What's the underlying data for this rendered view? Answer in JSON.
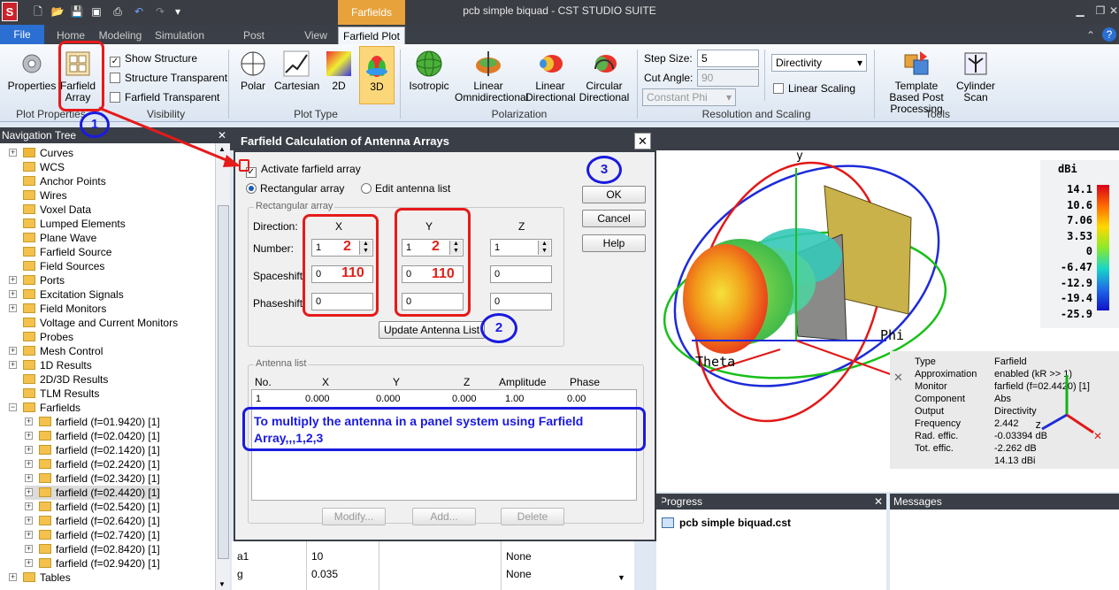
{
  "window": {
    "title": "pcb simple biquad - CST STUDIO SUITE",
    "context_tab_group": "Farfields"
  },
  "tabs": [
    "File",
    "Home",
    "Modeling",
    "Simulation",
    "Post Processing",
    "View",
    "Farfield Plot"
  ],
  "ribbon": {
    "properties": "Properties",
    "farfield_array": "Farfield Array",
    "plot_properties_label": "Plot Properties",
    "show_structure": "Show Structure",
    "structure_transparent": "Structure Transparent",
    "farfield_transparent": "Farfield Transparent",
    "visibility_label": "Visibility",
    "polar": "Polar",
    "cartesian": "Cartesian",
    "2d": "2D",
    "3d": "3D",
    "plot_type_label": "Plot Type",
    "isotropic": "Isotropic",
    "linear_omni": "Linear Omnidirectional",
    "linear_dir": "Linear Directional",
    "circular_dir": "Circular Directional",
    "polarization_label": "Polarization",
    "step_size_label": "Step Size:",
    "step_size_value": "5",
    "cut_angle_label": "Cut Angle:",
    "cut_angle_value": "90",
    "constant_phi": "Constant Phi",
    "directivity": "Directivity",
    "linear_scaling": "Linear Scaling",
    "resolution_label": "Resolution and Scaling",
    "template_pp": "Template Based Post Processing",
    "cylinder_scan": "Cylinder Scan",
    "tools_label": "Tools"
  },
  "nav": {
    "header": "Navigation Tree",
    "items": [
      "Curves",
      "WCS",
      "Anchor Points",
      "Wires",
      "Voxel Data",
      "Lumped Elements",
      "Plane Wave",
      "Farfield Source",
      "Field Sources",
      "Ports",
      "Excitation Signals",
      "Field Monitors",
      "Voltage and Current Monitors",
      "Probes",
      "Mesh Control",
      "1D Results",
      "2D/3D Results",
      "TLM Results",
      "Farfields",
      "farfield (f=01.9420) [1]",
      "farfield (f=02.0420) [1]",
      "farfield (f=02.1420) [1]",
      "farfield (f=02.2420) [1]",
      "farfield (f=02.3420) [1]",
      "farfield (f=02.4420) [1]",
      "farfield (f=02.5420) [1]",
      "farfield (f=02.6420) [1]",
      "farfield (f=02.7420) [1]",
      "farfield (f=02.8420) [1]",
      "farfield (f=02.9420) [1]",
      "Tables"
    ]
  },
  "dialog": {
    "title": "Farfield Calculation of Antenna Arrays",
    "activate": "Activate farfield array",
    "rect_array": "Rectangular array",
    "edit_list": "Edit antenna list",
    "rect_group": "Rectangular array",
    "direction_label": "Direction:",
    "x": "X",
    "y": "Y",
    "z": "Z",
    "number_label": "Number:",
    "spaceshift_label": "Spaceshift:",
    "phaseshift_label": "Phaseshift:",
    "num_x": "1",
    "num_y": "1",
    "num_z": "1",
    "space_x": "0",
    "space_y": "0",
    "space_z": "0",
    "phase_x": "0",
    "phase_y": "0",
    "phase_z": "0",
    "annot_num_x": "2",
    "annot_num_y": "2",
    "annot_space_x": "110",
    "annot_space_y": "110",
    "update_btn": "Update Antenna List",
    "ok": "OK",
    "cancel": "Cancel",
    "help": "Help",
    "antenna_list_label": "Antenna list",
    "cols": [
      "No.",
      "X",
      "Y",
      "Z",
      "Amplitude",
      "Phase"
    ],
    "row": [
      "1",
      "0.000",
      "0.000",
      "0.000",
      "1.00",
      "0.00"
    ],
    "modify": "Modify...",
    "add": "Add...",
    "delete": "Delete",
    "note": "To multiply the antenna in a panel system using Farfield Array,,,1,2,3"
  },
  "markers": {
    "m1": "1",
    "m2": "2",
    "m3": "3"
  },
  "params": [
    {
      "name": "a1",
      "value": "10",
      "type": "None"
    },
    {
      "name": "g",
      "value": "0.035",
      "type": "None"
    }
  ],
  "scale": {
    "unit": "dBi",
    "ticks": [
      "14.1",
      "10.6",
      "7.06",
      "3.53",
      "0",
      "-6.47",
      "-12.9",
      "-19.4",
      "-25.9"
    ]
  },
  "axes": {
    "y": "y",
    "phi": "Phi",
    "theta": "Theta",
    "z": "z"
  },
  "info": {
    "rows": [
      [
        "Type",
        "Farfield"
      ],
      [
        "Approximation",
        "enabled (kR >> 1)"
      ],
      [
        "Monitor",
        "farfield (f=02.4420) [1]"
      ],
      [
        "Component",
        "Abs"
      ],
      [
        "Output",
        "Directivity"
      ],
      [
        "Frequency",
        "2.442"
      ],
      [
        "Rad. effic.",
        "-0.03394 dB"
      ],
      [
        "Tot. effic.",
        "-2.262 dB"
      ],
      [
        "",
        "14.13 dBi"
      ]
    ]
  },
  "progress": {
    "header": "Progress",
    "file": "pcb simple biquad.cst"
  },
  "messages": {
    "header": "Messages"
  }
}
